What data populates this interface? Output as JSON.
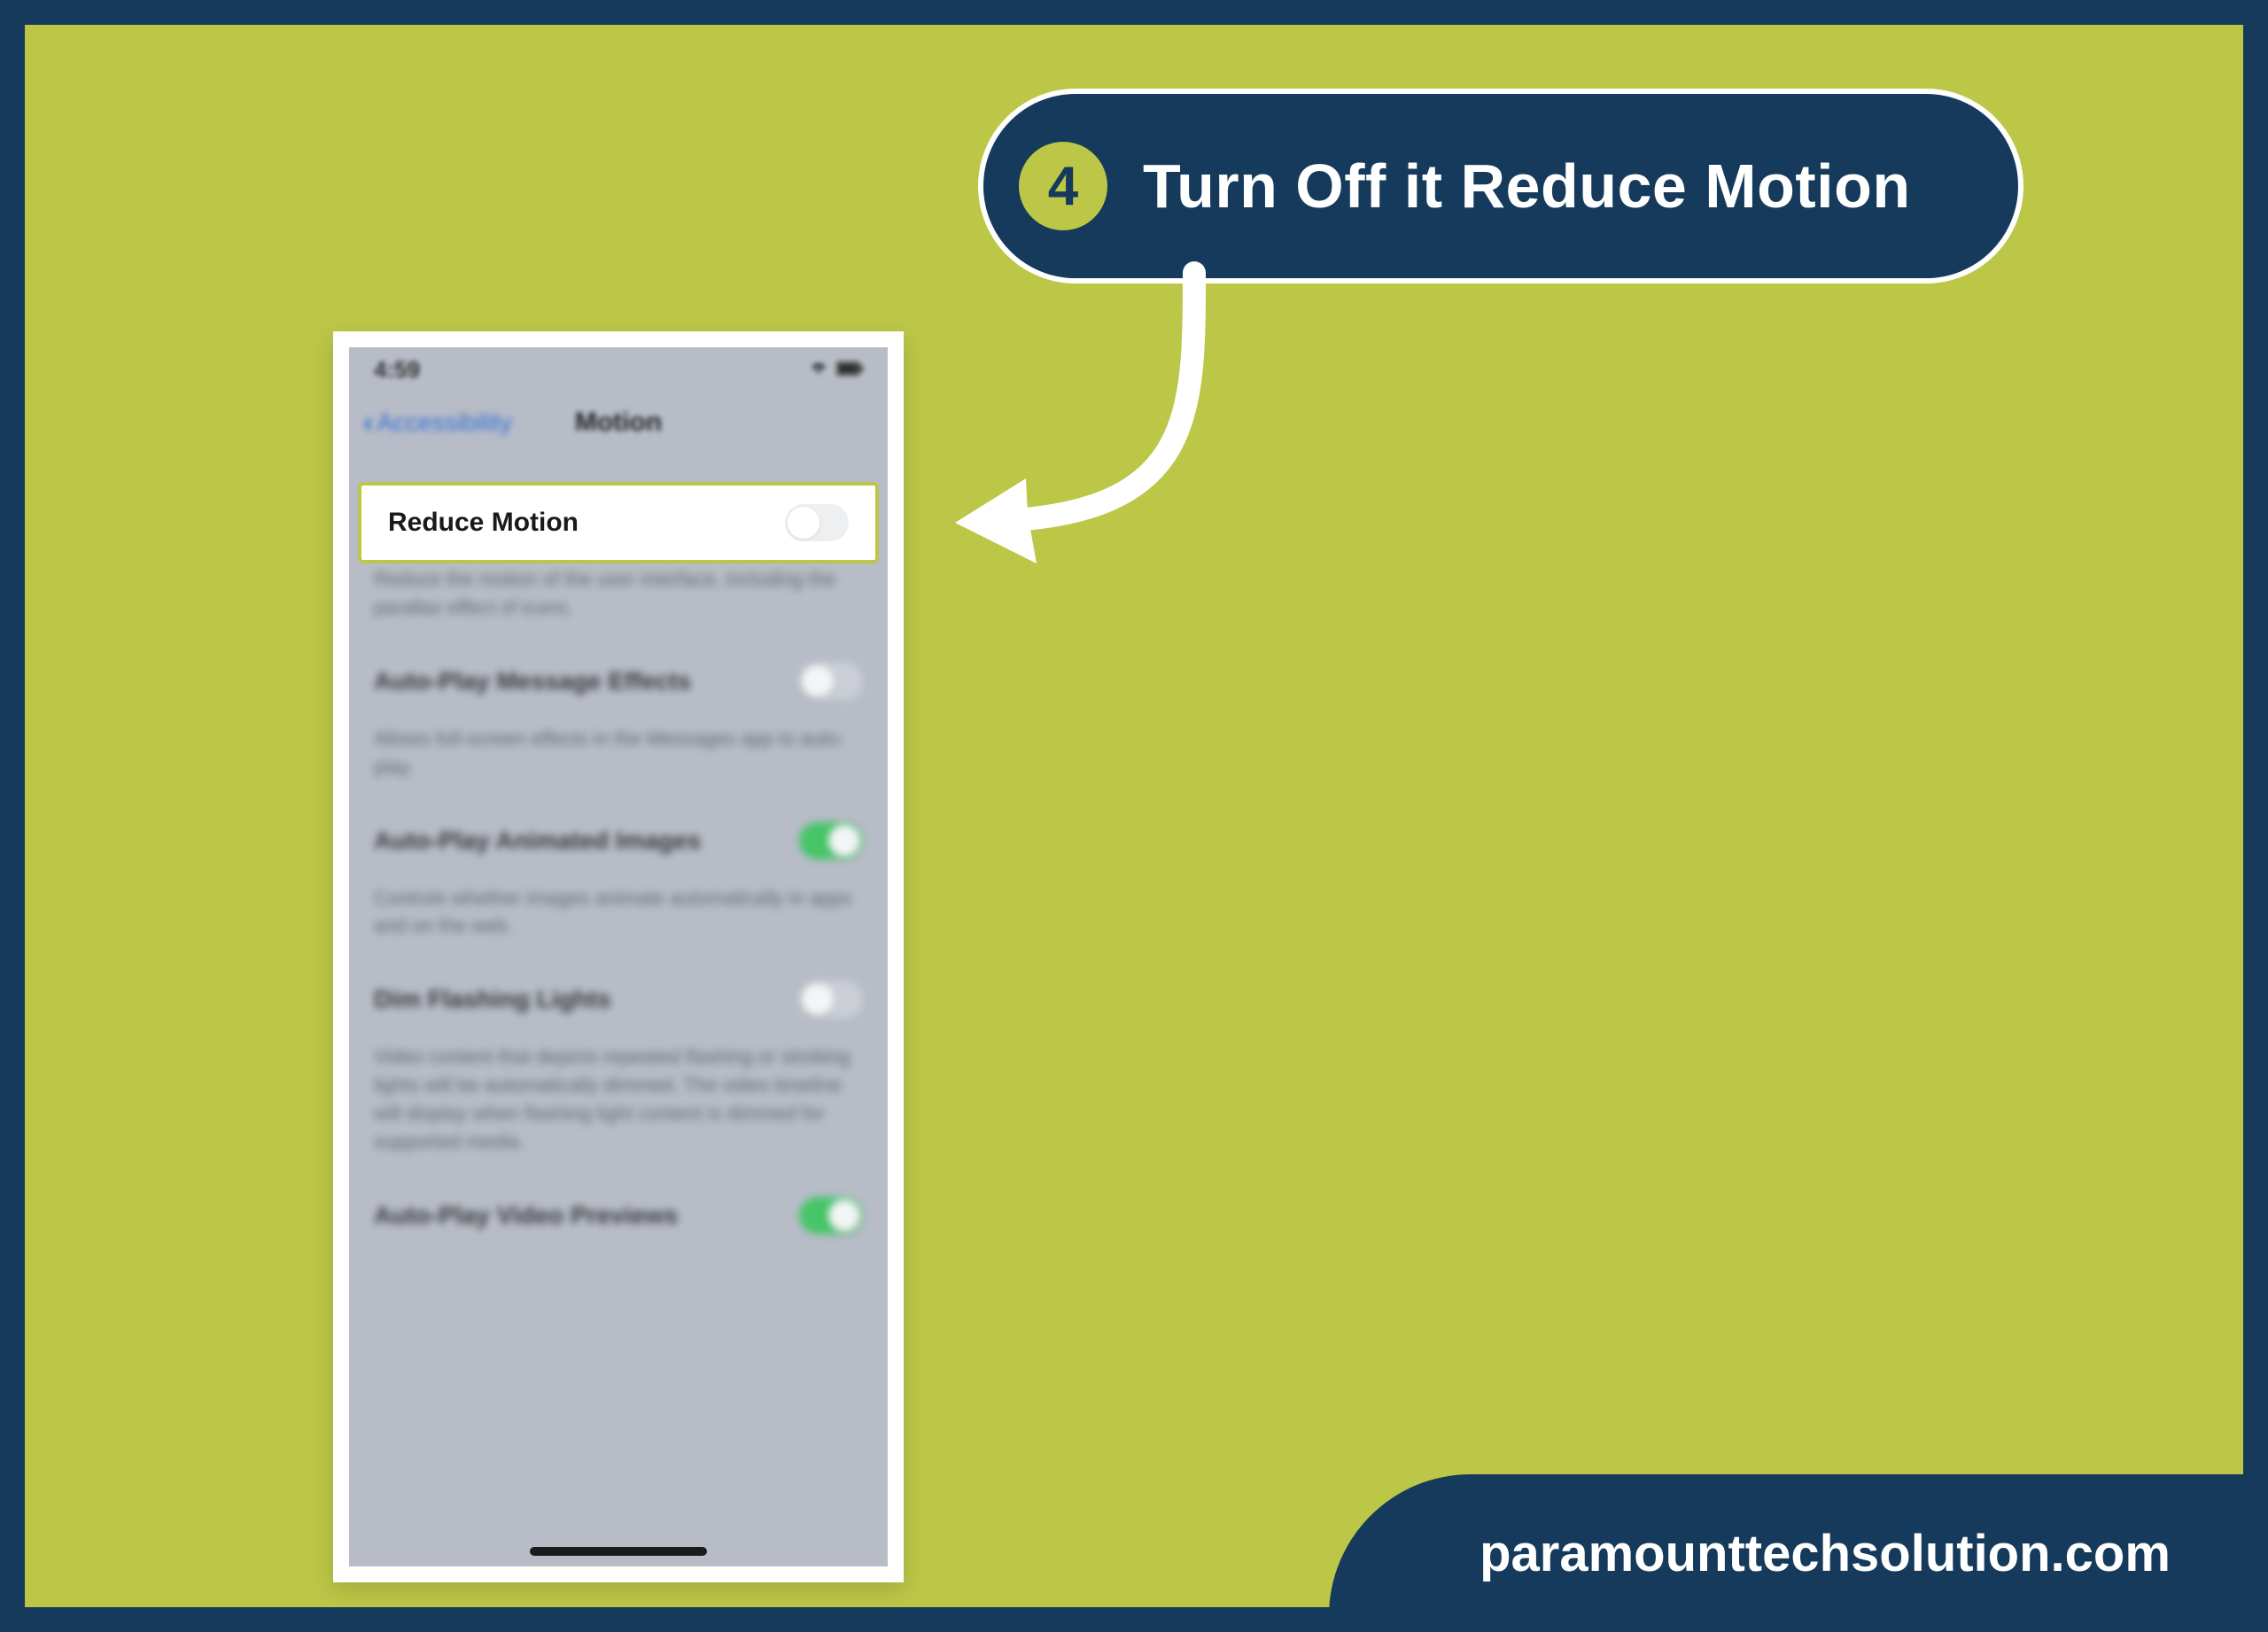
{
  "callout": {
    "step_number": "4",
    "title": "Turn Off it Reduce Motion"
  },
  "phone": {
    "status": {
      "time": "4:59",
      "wifi_icon": "wifi",
      "battery_icon": "battery"
    },
    "nav": {
      "back_label": "Accessibility",
      "title": "Motion"
    },
    "settings": [
      {
        "label": "Reduce Motion",
        "on": false,
        "highlighted": true,
        "desc": "Reduce the motion of the user interface, including the parallax effect of icons."
      },
      {
        "label": "Auto-Play Message Effects",
        "on": false,
        "desc": "Allows full-screen effects in the Messages app to auto-play."
      },
      {
        "label": "Auto-Play Animated Images",
        "on": true,
        "desc": "Controls whether images animate automatically in apps and on the web."
      },
      {
        "label": "Dim Flashing Lights",
        "on": false,
        "desc": "Video content that depicts repeated flashing or strobing lights will be automatically dimmed. The video timeline will display when flashing light content is dimmed for supported media."
      },
      {
        "label": "Auto-Play Video Previews",
        "on": true,
        "desc": ""
      }
    ]
  },
  "brand": {
    "url": "paramounttechsolution.com"
  },
  "colors": {
    "bg": "#bcc747",
    "frame": "#153a5b",
    "accent": "#34c759"
  }
}
